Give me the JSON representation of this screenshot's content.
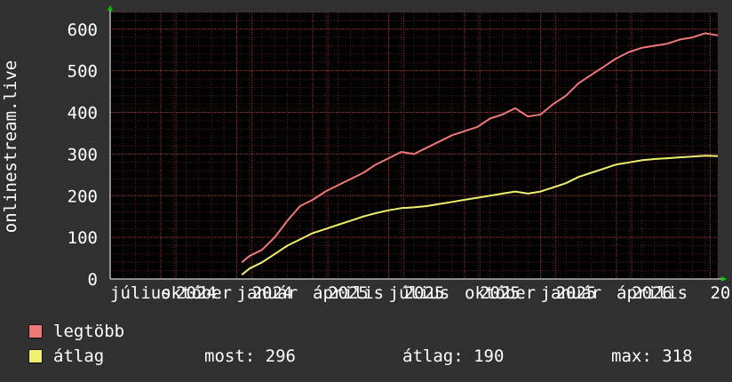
{
  "chart_data": {
    "type": "line",
    "ylabel": "onlinestream.live",
    "ylim": [
      0,
      640
    ],
    "yticks": [
      0,
      100,
      200,
      300,
      400,
      500,
      600
    ],
    "xlim": [
      0,
      24
    ],
    "xticks": [
      {
        "x": 0,
        "label": "július"
      },
      {
        "x": 2,
        "label": "október"
      },
      {
        "x": 2.6,
        "label": "2024"
      },
      {
        "x": 5,
        "label": "január"
      },
      {
        "x": 5.6,
        "label": "2024"
      },
      {
        "x": 8,
        "label": "április"
      },
      {
        "x": 8.6,
        "label": "2025"
      },
      {
        "x": 11,
        "label": "július"
      },
      {
        "x": 11.6,
        "label": "2025"
      },
      {
        "x": 14,
        "label": "október"
      },
      {
        "x": 14.6,
        "label": "2025"
      },
      {
        "x": 17,
        "label": "január"
      },
      {
        "x": 17.6,
        "label": "2025"
      },
      {
        "x": 20,
        "label": "április"
      },
      {
        "x": 20.6,
        "label": "2026"
      },
      {
        "x": 23.7,
        "label": "20"
      }
    ],
    "grid": true,
    "series": [
      {
        "name": "legtöbb",
        "color": "#f07878",
        "x": [
          5.2,
          5.5,
          6,
          6.5,
          7,
          7.5,
          8,
          8.5,
          9,
          9.5,
          10,
          10.5,
          11,
          11.5,
          12,
          12.5,
          13,
          13.5,
          14,
          14.5,
          15,
          15.5,
          16,
          16.5,
          17,
          17.5,
          18,
          18.5,
          19,
          19.5,
          20,
          20.5,
          21,
          21.5,
          22,
          22.5,
          23,
          23.5,
          24
        ],
        "values": [
          40,
          55,
          70,
          100,
          140,
          175,
          190,
          210,
          225,
          240,
          255,
          275,
          290,
          305,
          300,
          315,
          330,
          345,
          355,
          365,
          385,
          395,
          410,
          390,
          395,
          420,
          440,
          470,
          490,
          510,
          530,
          545,
          555,
          560,
          565,
          575,
          580,
          590,
          585
        ]
      },
      {
        "name": "átlag",
        "color": "#f0f070",
        "x": [
          5.2,
          5.5,
          6,
          6.5,
          7,
          7.5,
          8,
          8.5,
          9,
          9.5,
          10,
          10.5,
          11,
          11.5,
          12,
          12.5,
          13,
          13.5,
          14,
          14.5,
          15,
          15.5,
          16,
          16.5,
          17,
          17.5,
          18,
          18.5,
          19,
          19.5,
          20,
          20.5,
          21,
          21.5,
          22,
          22.5,
          23,
          23.5,
          24
        ],
        "values": [
          10,
          25,
          40,
          60,
          80,
          95,
          110,
          120,
          130,
          140,
          150,
          158,
          165,
          170,
          172,
          175,
          180,
          185,
          190,
          195,
          200,
          205,
          210,
          205,
          210,
          220,
          230,
          245,
          255,
          265,
          275,
          280,
          285,
          288,
          290,
          292,
          294,
          296,
          295
        ]
      }
    ]
  },
  "legend": {
    "max_label": "legtöbb",
    "avg_label": "átlag",
    "max_color": "#f07878",
    "avg_color": "#f0f070"
  },
  "stats": {
    "now": "most: 296",
    "avg": "átlag: 190",
    "max": "max: 318"
  }
}
